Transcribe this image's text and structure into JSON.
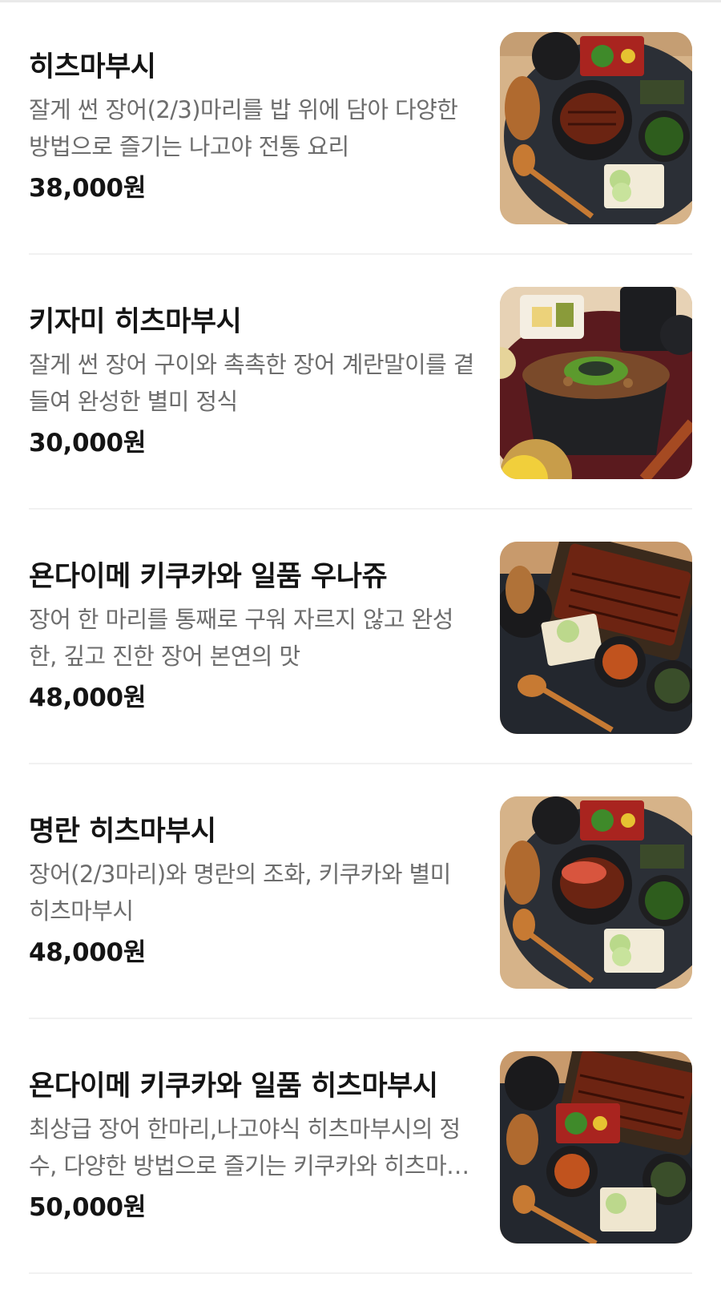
{
  "menu": {
    "items": [
      {
        "name": "히츠마부시",
        "description": "잘게 썬 장어(2/3)마리를 밥 위에 담아 다양한 방법으로 즐기는 나고야 전통 요리",
        "price": "38,000원",
        "image": "hitsumabushi-set-photo"
      },
      {
        "name": "키자미 히츠마부시",
        "description": "잘게 썬 장어 구이와 촉촉한 장어 계란말이를 곁들여 완성한 별미 정식",
        "price": "30,000원",
        "image": "kizami-hitsumabushi-photo"
      },
      {
        "name": "욘다이메 키쿠카와 일품 우나쥬",
        "description": "장어 한 마리를 통째로 구워 자르지 않고 완성한, 깊고 진한 장어 본연의 맛",
        "price": "48,000원",
        "image": "unaju-set-photo"
      },
      {
        "name": "명란 히츠마부시",
        "description": "장어(2/3마리)와 명란의 조화, 키쿠카와 별미 히츠마부시",
        "price": "48,000원",
        "image": "mentaiko-hitsumabushi-photo"
      },
      {
        "name": "욘다이메 키쿠카와 일품 히츠마부시",
        "description": "최상급 장어 한마리,나고야식 히츠마부시의 정수, 다양한 방법으로 즐기는 키쿠카와 히츠마부시",
        "price": "50,000원",
        "image": "premium-hitsumabushi-photo"
      }
    ]
  },
  "colors": {
    "name": "#141414",
    "description": "#6d6d6d",
    "divider": "#f1f1f1",
    "tray": "#2b2f36",
    "eel": "#6b2412",
    "wood": "#d9b48a"
  }
}
